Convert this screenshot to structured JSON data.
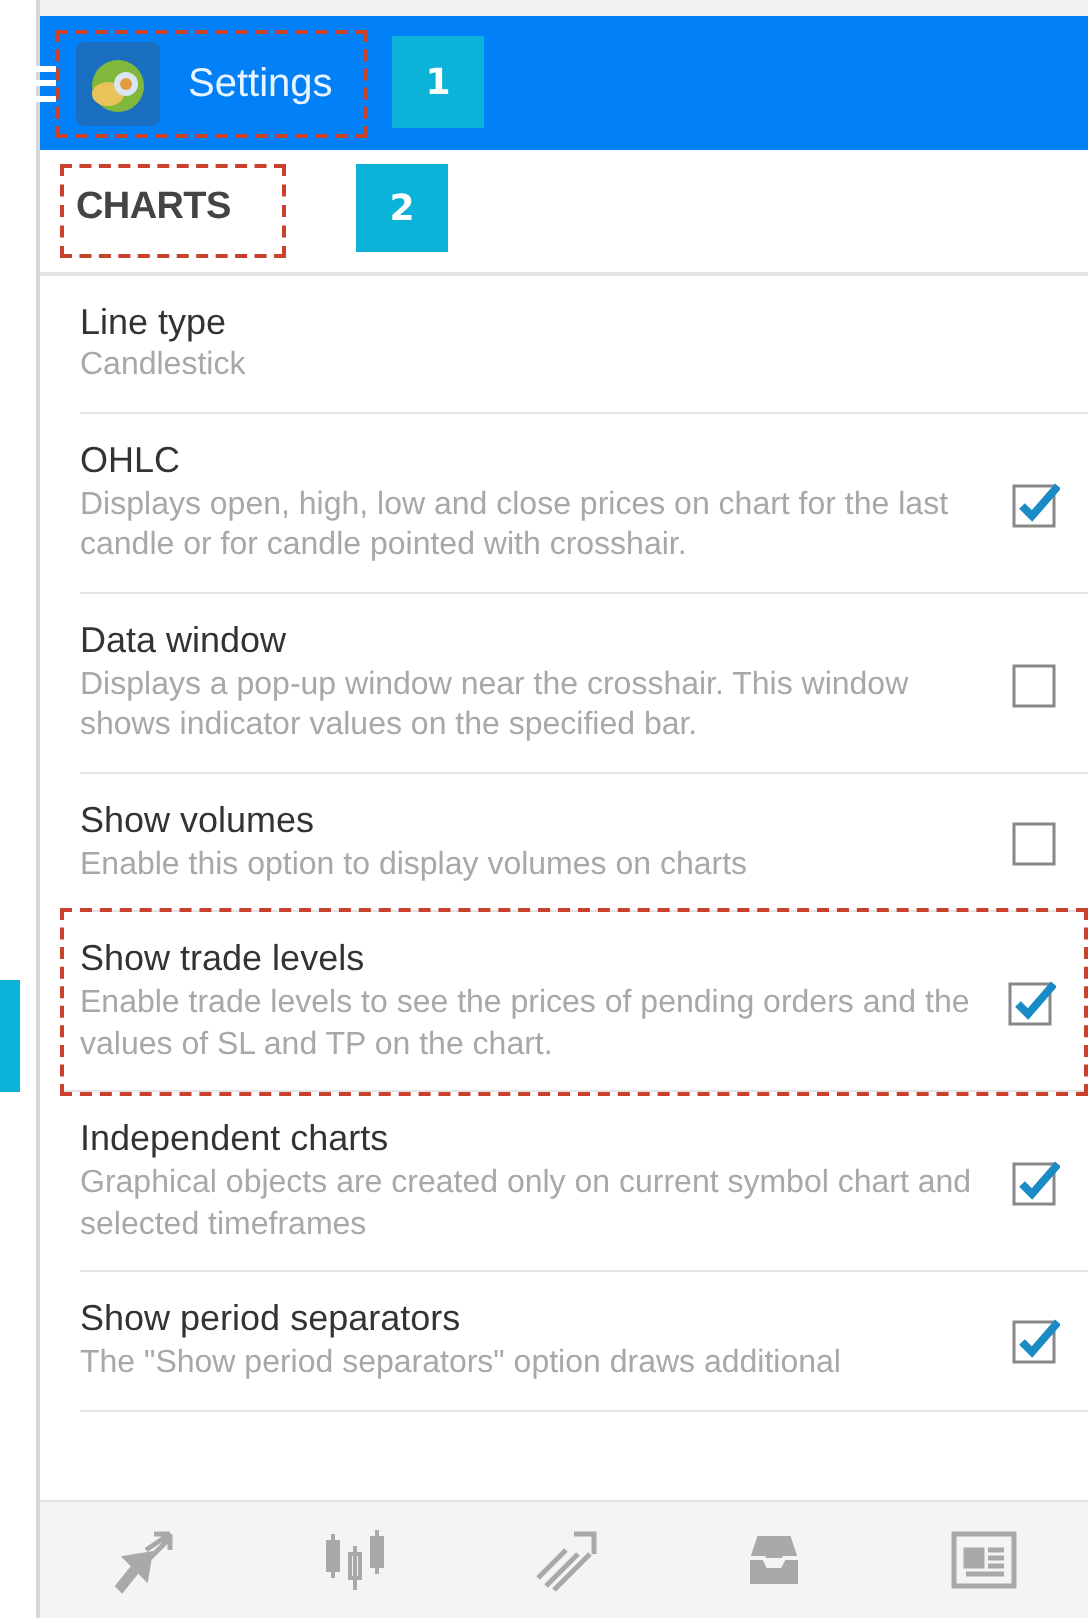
{
  "header": {
    "title": "Settings",
    "highlighted": true,
    "callout": "1"
  },
  "section": {
    "title": "CHARTS",
    "highlighted": true,
    "callout": "2"
  },
  "settings": [
    {
      "kind": "value",
      "title": "Line type",
      "description": "Candlestick",
      "highlighted": false
    },
    {
      "kind": "checkbox",
      "title": "OHLC",
      "description": "Displays open, high, low and close prices on chart for the last candle or for candle pointed with crosshair.",
      "checked": true,
      "highlighted": false
    },
    {
      "kind": "checkbox",
      "title": "Data window",
      "description": "Displays a pop-up window near the crosshair. This window shows indicator values on the specified bar.",
      "checked": false,
      "highlighted": false
    },
    {
      "kind": "checkbox",
      "title": "Show volumes",
      "description": "Enable this option to display volumes on charts",
      "checked": false,
      "highlighted": false
    },
    {
      "kind": "checkbox",
      "title": "Show trade levels",
      "description": "Enable trade levels to see the prices of pending orders and the values of SL and TP on the chart.",
      "checked": true,
      "highlighted": true
    },
    {
      "kind": "checkbox",
      "title": "Independent charts",
      "description": "Graphical objects are created only on current symbol chart and selected timeframes",
      "checked": true,
      "highlighted": false
    },
    {
      "kind": "checkbox",
      "title": "Show period separators",
      "description": "The \"Show period separators\" option draws additional",
      "checked": true,
      "highlighted": false
    }
  ],
  "bottom_nav": [
    {
      "kind": "trade"
    },
    {
      "kind": "candles"
    },
    {
      "kind": "signals"
    },
    {
      "kind": "inbox"
    },
    {
      "kind": "news"
    }
  ]
}
